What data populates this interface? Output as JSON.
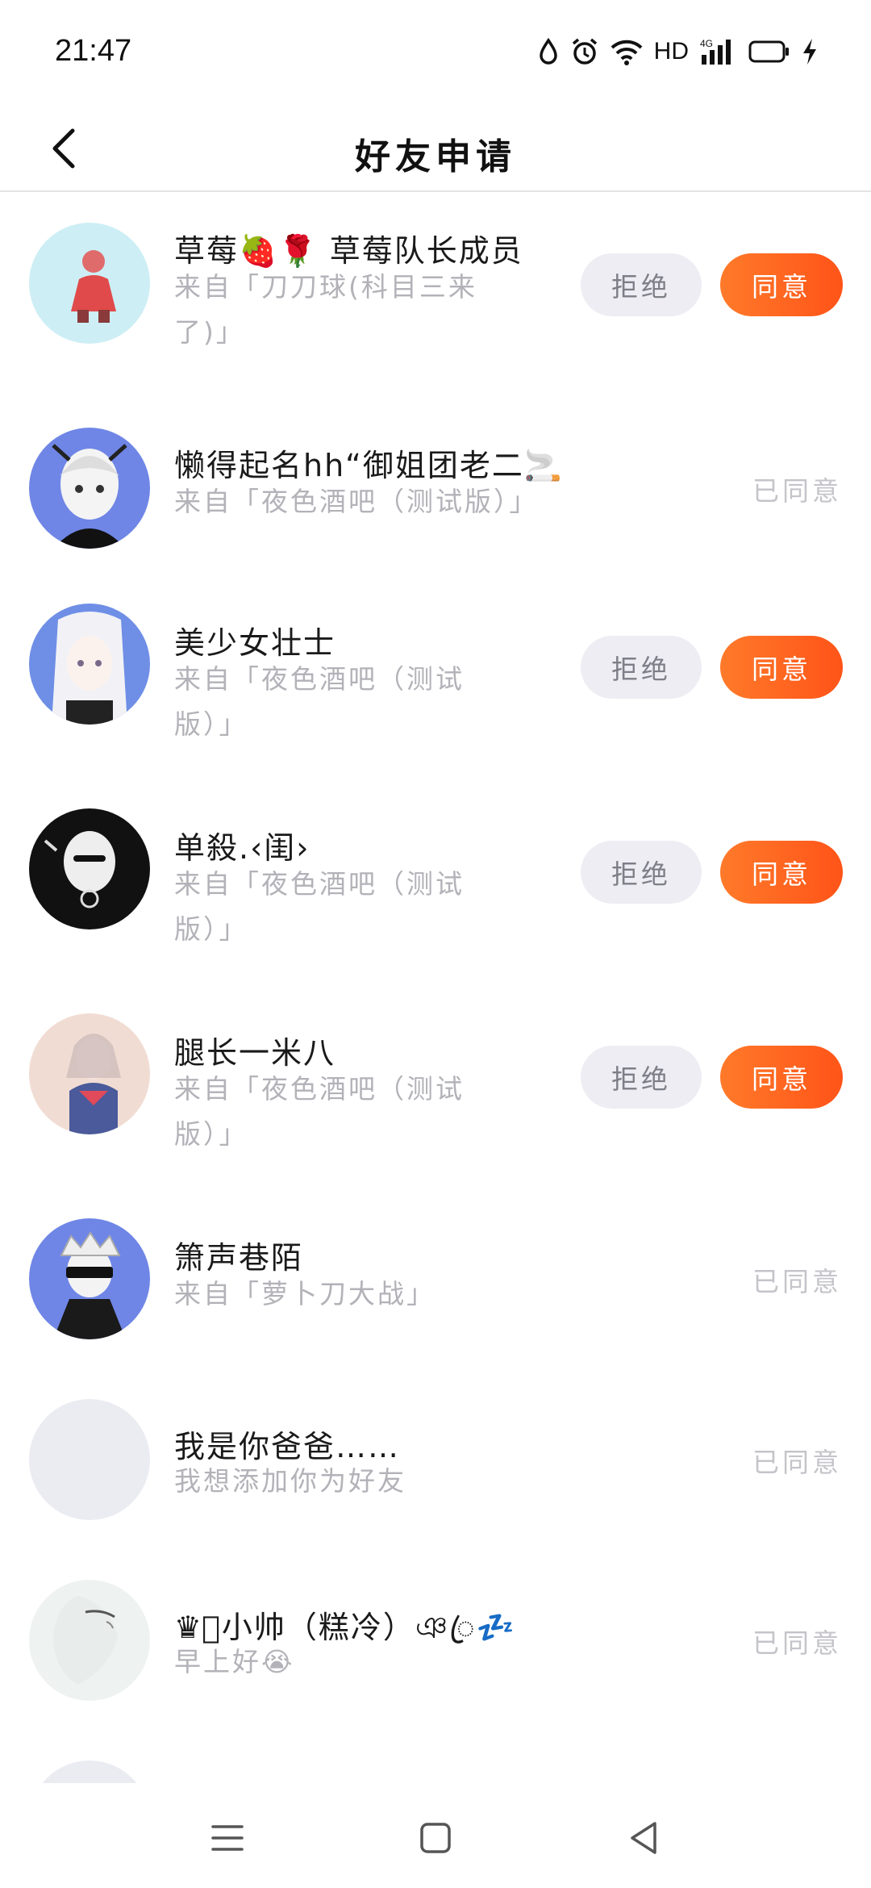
{
  "status_bar": {
    "time": "21:47",
    "hd": "HD",
    "network": "4G",
    "icons": [
      "water-drop-icon",
      "alarm-icon",
      "wifi-icon",
      "signal-icon",
      "battery-icon",
      "charging-icon"
    ]
  },
  "header": {
    "title": "好友申请",
    "back_icon": "chevron-left-icon"
  },
  "buttons": {
    "reject": "拒绝",
    "accept": "同意",
    "agreed": "已同意"
  },
  "requests": [
    {
      "name": "草莓🍓🌹 草莓队长成员",
      "source_line1": "来自「刀刀球(科目三来",
      "source_line2": "了)」",
      "state": "pending",
      "avatar_color": "#cdeef5"
    },
    {
      "name": "懒得起名hh“御姐团老二🚬",
      "source_line1": "来自「夜色酒吧（测试版）」",
      "source_line2": "",
      "state": "agreed",
      "avatar_color": "#6f86e6"
    },
    {
      "name": "美少女壮士",
      "source_line1": "来自「夜色酒吧（测试",
      "source_line2": "版）」",
      "state": "pending",
      "avatar_color": "#6f8fe6"
    },
    {
      "name": "单殺.‹闺›",
      "source_line1": "来自「夜色酒吧（测试",
      "source_line2": "版）」",
      "state": "pending",
      "avatar_color": "#111111"
    },
    {
      "name": "腿长一米八",
      "source_line1": "来自「夜色酒吧（测试",
      "source_line2": "版）」",
      "state": "pending",
      "avatar_color": "#f1dcd3"
    },
    {
      "name": "箫声巷陌",
      "source_line1": "来自「萝卜刀大战」",
      "source_line2": "",
      "state": "agreed",
      "avatar_color": "#6f86e6"
    },
    {
      "name": "我是你爸爸……",
      "source_line1": "我想添加你为好友",
      "source_line2": "",
      "state": "agreed",
      "avatar_color": "#ebebf2"
    },
    {
      "name": "♛ꦿ小帅（糕冷）ঞꦿ💤",
      "source_line1": "早上好😭",
      "source_line2": "",
      "state": "agreed",
      "avatar_color": "#eef2f0"
    }
  ],
  "system_nav": {
    "icons": [
      "menu-icon",
      "home-square-icon",
      "back-triangle-icon"
    ]
  }
}
